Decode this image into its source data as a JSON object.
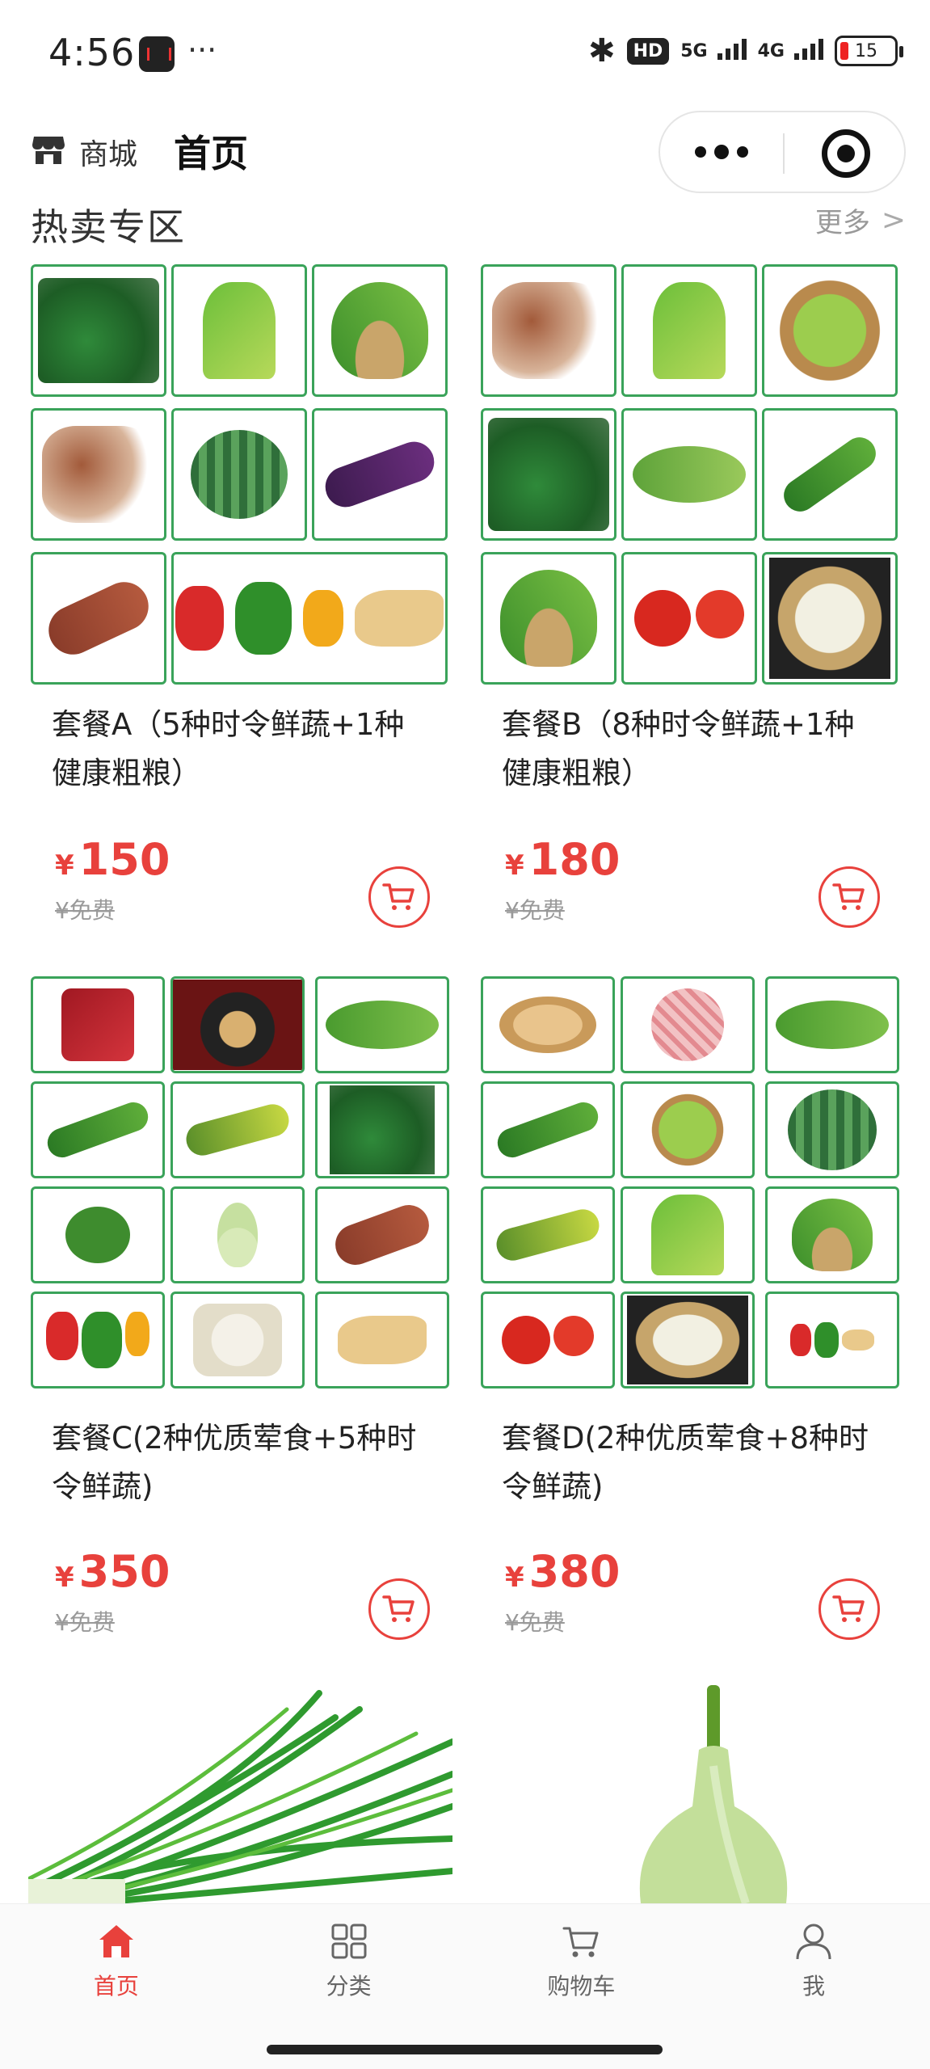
{
  "status_bar": {
    "time": "4:56",
    "dots": "···",
    "hd": "HD",
    "net1": "5G",
    "net2": "4G",
    "battery": "15"
  },
  "header": {
    "shop_label": "商城",
    "title": "首页"
  },
  "section": {
    "title": "热卖专区",
    "more": "更多"
  },
  "products": [
    {
      "title": "套餐A（5种时令鲜蔬+1种健康粗粮）",
      "price": "150",
      "currency": "¥",
      "original": "¥免费"
    },
    {
      "title": "套餐B（8种时令鲜蔬+1种健康粗粮）",
      "price": "180",
      "currency": "¥",
      "original": "¥免费"
    },
    {
      "title": "套餐C(2种优质荤食+5种时令鲜蔬)",
      "price": "350",
      "currency": "¥",
      "original": "¥免费"
    },
    {
      "title": "套餐D(2种优质荤食+8种时令鲜蔬)",
      "price": "380",
      "currency": "¥",
      "original": "¥免费"
    }
  ],
  "tabbar": {
    "items": [
      {
        "label": "首页",
        "icon": "home-icon",
        "active": true
      },
      {
        "label": "分类",
        "icon": "category-icon",
        "active": false
      },
      {
        "label": "购物车",
        "icon": "cart-icon",
        "active": false
      },
      {
        "label": "我",
        "icon": "user-icon",
        "active": false
      }
    ]
  },
  "colors": {
    "accent": "#e8413c",
    "border_green": "#3aa35a"
  }
}
